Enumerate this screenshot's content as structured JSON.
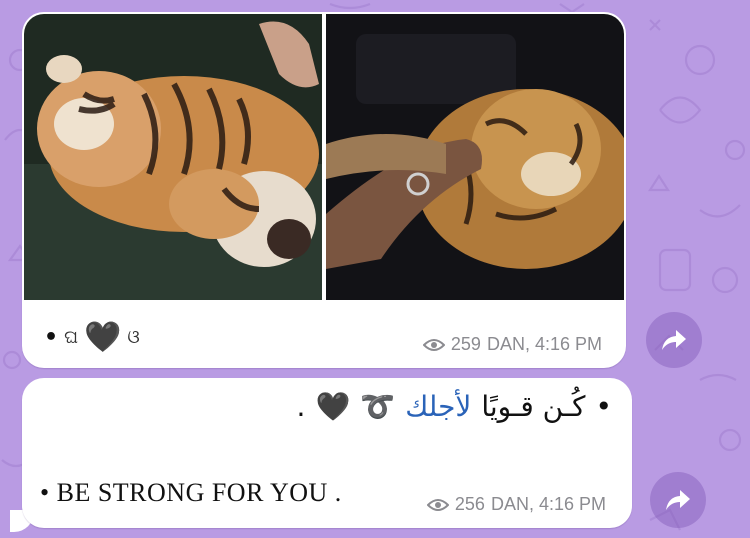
{
  "colors": {
    "wallpaper": "#b99be3",
    "bubble": "#ffffff",
    "meta_text": "#8b8b90",
    "link_blue": "#2a63b8"
  },
  "messages": [
    {
      "caption": {
        "bullet": "•",
        "left_wing": "ଘ",
        "heart": "🖤",
        "right_wing": "ଓ"
      },
      "views": "259",
      "meta_time": "DAN, 4:16 PM",
      "photos": [
        "tiger-cub-sleeping-photo",
        "tiger-cub-with-hand-photo"
      ]
    },
    {
      "arabic_line": {
        "bullet": "•",
        "text_black": "كُـن قـويًا",
        "text_blue": "لأجلك",
        "symbol": "➰",
        "heart": "🖤",
        "end": "."
      },
      "english_line": "• BE STRONG FOR YOU .",
      "views": "256",
      "meta_time": "DAN, 4:16 PM"
    }
  ],
  "icons": {
    "views": "eye-icon",
    "share": "share-arrow-icon"
  }
}
